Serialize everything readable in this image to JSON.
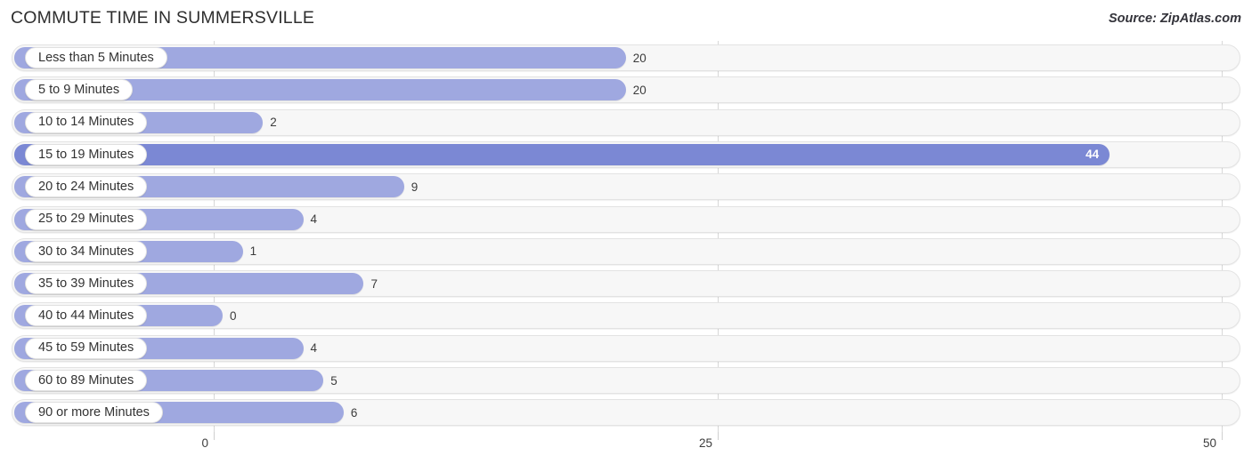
{
  "header": {
    "title": "COMMUTE TIME IN SUMMERSVILLE",
    "source": "Source: ZipAtlas.com"
  },
  "colors": {
    "bar": "#9fa8e0",
    "bar_max": "#7b88d4",
    "track": "#f7f7f7",
    "gridline": "#d8d8d8",
    "text": "#333333"
  },
  "chart_data": {
    "type": "bar",
    "orientation": "horizontal",
    "title": "COMMUTE TIME IN SUMMERSVILLE",
    "subtitle": "",
    "xlabel": "",
    "ylabel": "",
    "xlim": [
      0,
      50
    ],
    "xticks": [
      0,
      25,
      50
    ],
    "xtick_labels": [
      "0",
      "25",
      "50"
    ],
    "grid": true,
    "legend": false,
    "highlight_rule": "max-value",
    "categories": [
      "Less than 5 Minutes",
      "5 to 9 Minutes",
      "10 to 14 Minutes",
      "15 to 19 Minutes",
      "20 to 24 Minutes",
      "25 to 29 Minutes",
      "30 to 34 Minutes",
      "35 to 39 Minutes",
      "40 to 44 Minutes",
      "45 to 59 Minutes",
      "60 to 89 Minutes",
      "90 or more Minutes"
    ],
    "values": [
      20,
      20,
      2,
      44,
      9,
      4,
      1,
      7,
      0,
      4,
      5,
      6
    ],
    "value_labels": [
      "20",
      "20",
      "2",
      "44",
      "9",
      "4",
      "1",
      "7",
      "0",
      "4",
      "5",
      "6"
    ]
  }
}
